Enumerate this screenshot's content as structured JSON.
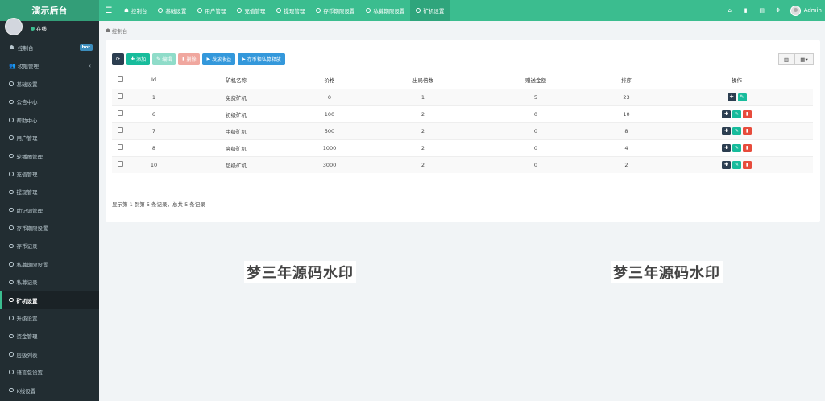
{
  "app": {
    "title": "演示后台"
  },
  "topnav": {
    "tabs": [
      {
        "label": "控制台",
        "icon": "dashboard-icon"
      },
      {
        "label": "基础设置",
        "icon": "circle-icon"
      },
      {
        "label": "用户管理",
        "icon": "circle-icon"
      },
      {
        "label": "充值管理",
        "icon": "circle-icon"
      },
      {
        "label": "提现管理",
        "icon": "circle-icon"
      },
      {
        "label": "存币期限设置",
        "icon": "circle-icon"
      },
      {
        "label": "私募期限设置",
        "icon": "circle-icon"
      },
      {
        "label": "矿机设置",
        "icon": "circle-icon",
        "active": true
      }
    ],
    "admin_name": "Admin"
  },
  "sidebar": {
    "status": "在线",
    "items": [
      {
        "label": "控制台",
        "badge": "hot"
      },
      {
        "label": "权限管理",
        "chevron": "‹"
      },
      {
        "label": "基础设置"
      },
      {
        "label": "公告中心"
      },
      {
        "label": "帮助中心"
      },
      {
        "label": "用户管理"
      },
      {
        "label": "轮播图管理"
      },
      {
        "label": "充值管理"
      },
      {
        "label": "提现管理"
      },
      {
        "label": "助记词管理"
      },
      {
        "label": "存币期限设置"
      },
      {
        "label": "存币记录"
      },
      {
        "label": "私募期限设置"
      },
      {
        "label": "私募记录"
      },
      {
        "label": "矿机设置",
        "active": true
      },
      {
        "label": "升级设置"
      },
      {
        "label": "资金管理"
      },
      {
        "label": "层级列表"
      },
      {
        "label": "语言包设置"
      },
      {
        "label": "K线设置"
      }
    ]
  },
  "breadcrumb": {
    "label": "控制台"
  },
  "toolbar": {
    "add": "添加",
    "edit": "编辑",
    "delete": "删除",
    "distribute": "发放收益",
    "release": "存币和私募释放"
  },
  "table": {
    "headers": [
      "Id",
      "矿机名称",
      "价格",
      "出局倍数",
      "赠送金额",
      "排序",
      "操作"
    ],
    "rows": [
      {
        "id": "1",
        "name": "免费矿机",
        "price": "0",
        "multiple": "1",
        "gift": "5",
        "sort": "23",
        "ops": [
          "move",
          "edit"
        ]
      },
      {
        "id": "6",
        "name": "初级矿机",
        "price": "100",
        "multiple": "2",
        "gift": "0",
        "sort": "10",
        "ops": [
          "move",
          "edit",
          "delete"
        ]
      },
      {
        "id": "7",
        "name": "中级矿机",
        "price": "500",
        "multiple": "2",
        "gift": "0",
        "sort": "8",
        "ops": [
          "move",
          "edit",
          "delete"
        ]
      },
      {
        "id": "8",
        "name": "高级矿机",
        "price": "1000",
        "multiple": "2",
        "gift": "0",
        "sort": "4",
        "ops": [
          "move",
          "edit",
          "delete"
        ]
      },
      {
        "id": "10",
        "name": "超级矿机",
        "price": "3000",
        "multiple": "2",
        "gift": "0",
        "sort": "2",
        "ops": [
          "move",
          "edit",
          "delete"
        ]
      }
    ],
    "summary": "显示第 1 到第 5 条记录，总共 5 条记录"
  },
  "watermark": {
    "text1": "梦三年源码水印",
    "text2": "梦三年源码水印"
  },
  "colors": {
    "brand": "#3bbd8f",
    "sidebar_bg": "#222d32",
    "dark_btn": "#2c3e50",
    "green_btn": "#18bc9c",
    "red_btn": "#e74c3c",
    "blue_btn": "#3498db"
  }
}
